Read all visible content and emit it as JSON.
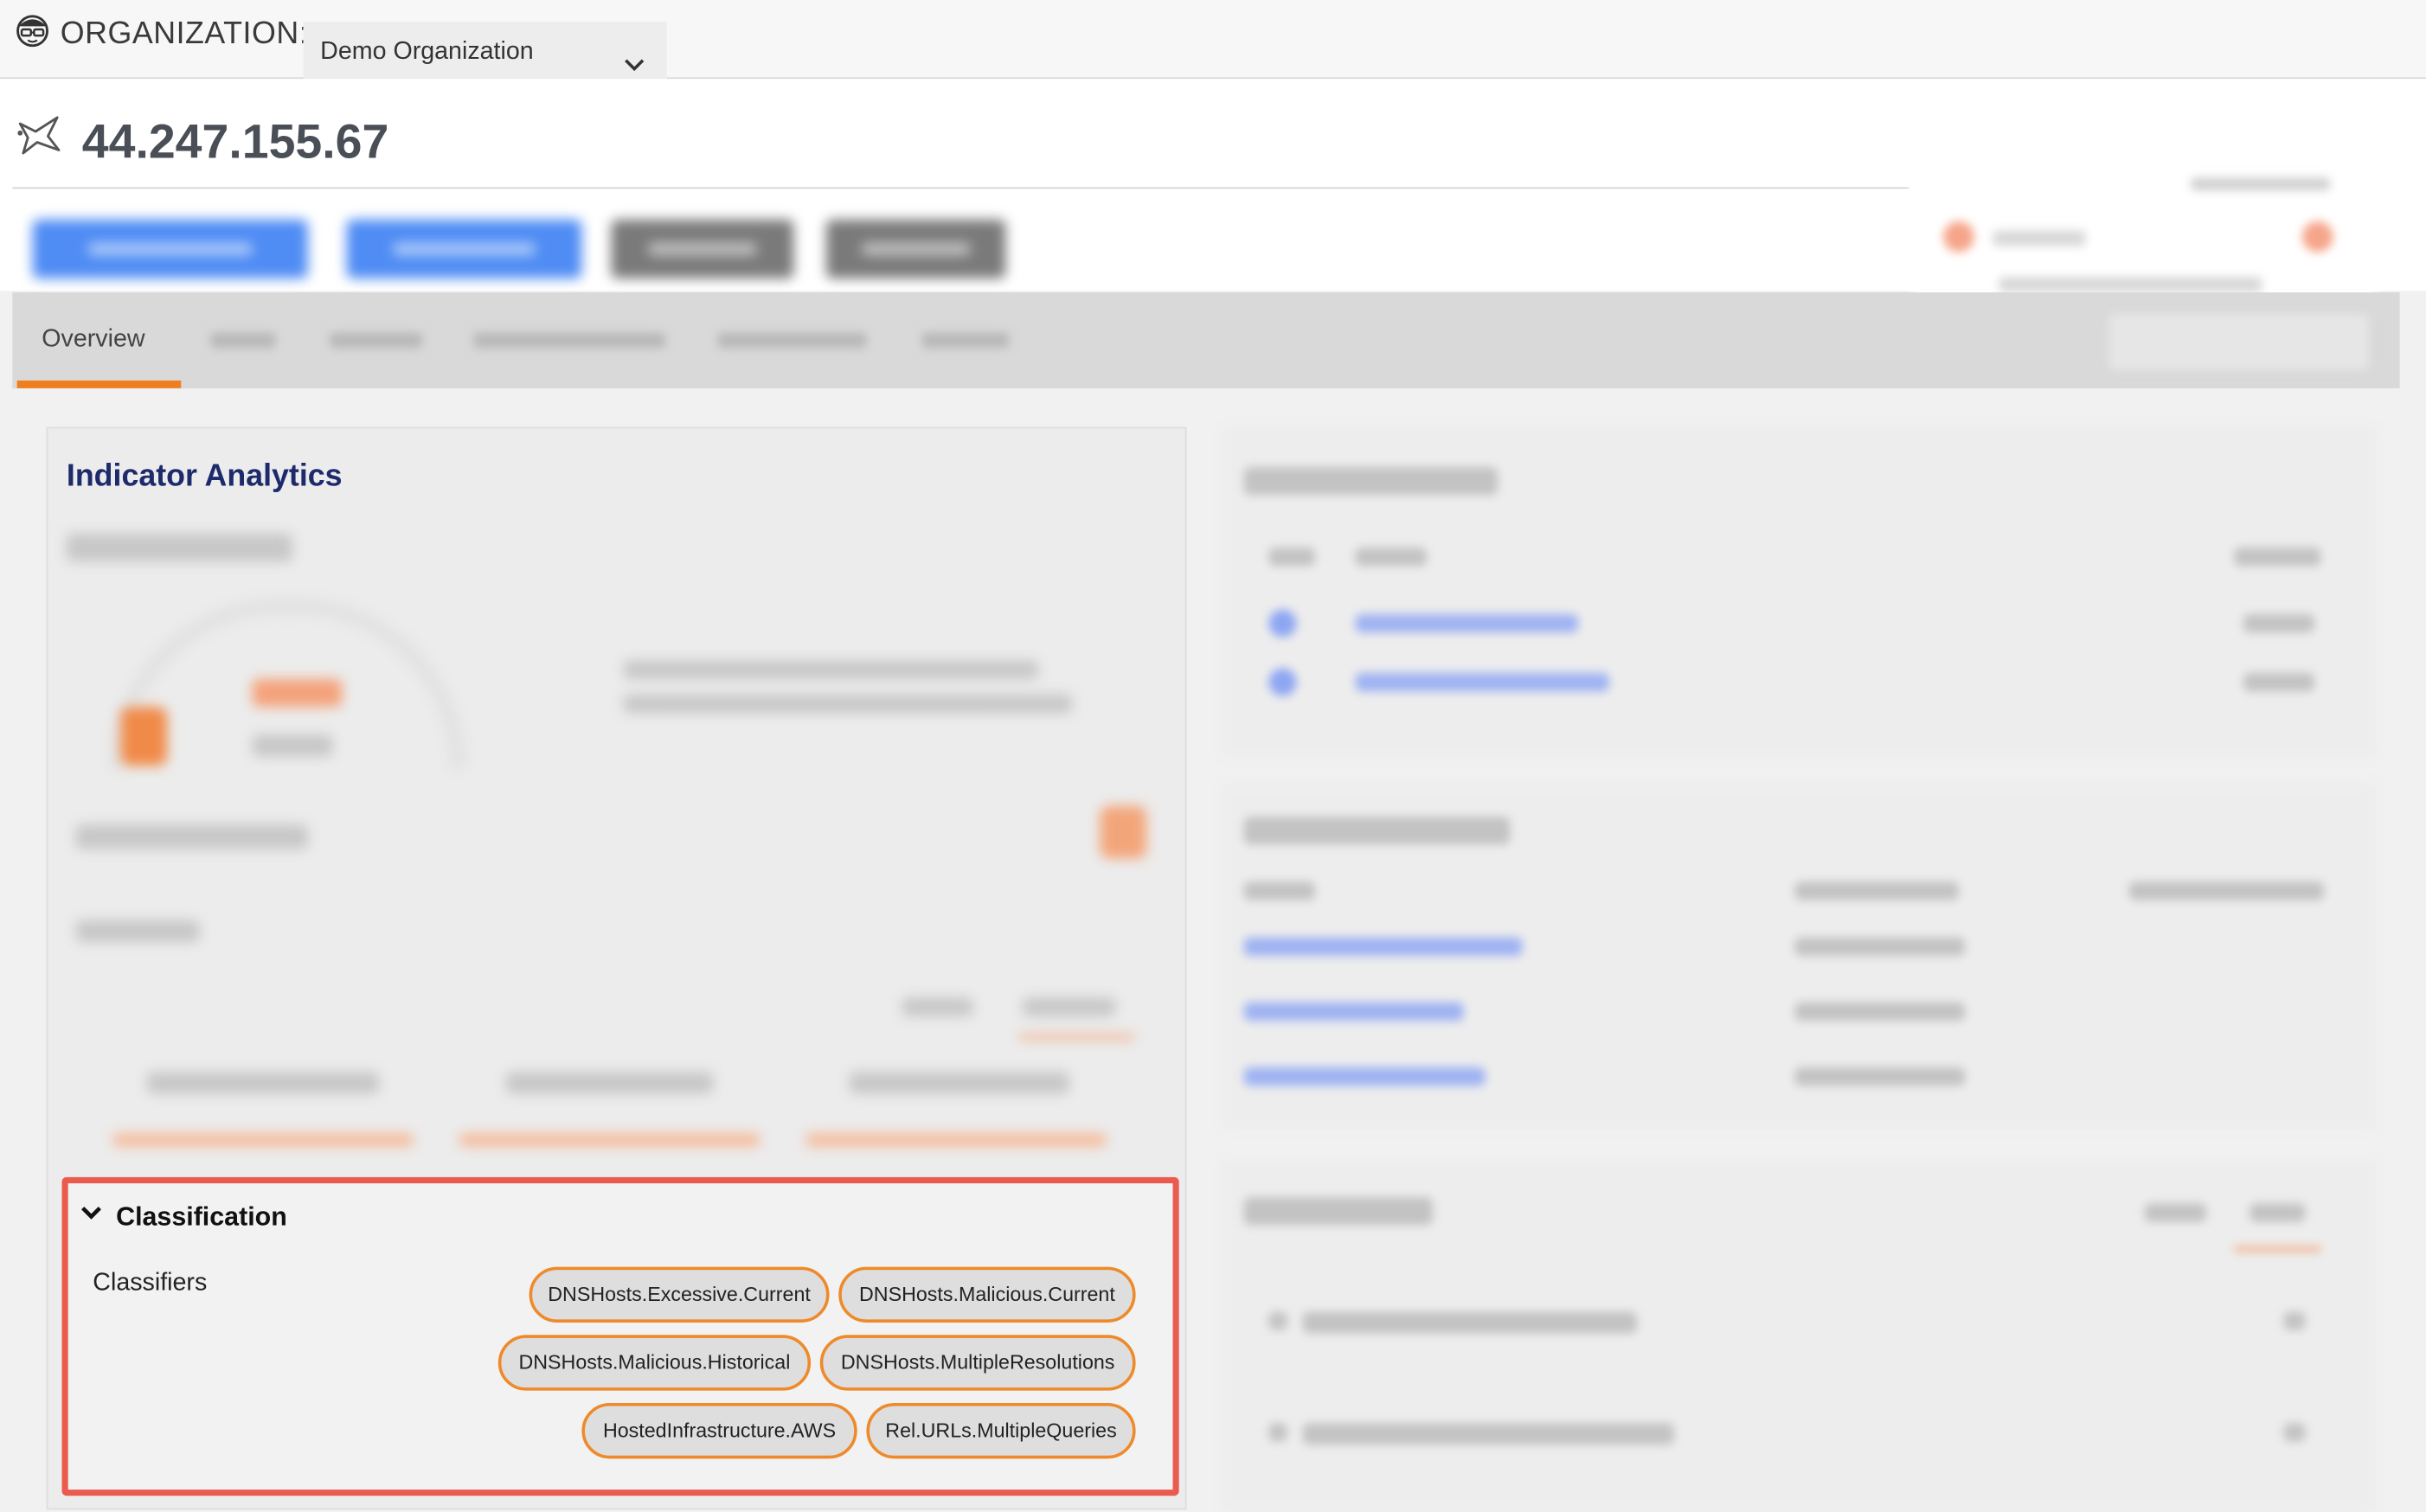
{
  "org_bar": {
    "label": "ORGANIZATION:",
    "selected_org": "Demo Organization",
    "icon": "user-glasses-icon",
    "select_icon": "chevron-down-icon"
  },
  "header": {
    "title": "44.247.155.67",
    "icon": "indicator-hand-icon"
  },
  "tabs": {
    "active_label": "Overview",
    "accent_color": "#f07e1e"
  },
  "left_card": {
    "title": "Indicator Analytics"
  },
  "classification": {
    "title": "Classification",
    "classifiers_label": "Classifiers",
    "chips": [
      "DNSHosts.Excessive.Current",
      "DNSHosts.Malicious.Current",
      "DNSHosts.Malicious.Historical",
      "DNSHosts.MultipleResolutions",
      "HostedInfrastructure.AWS",
      "Rel.URLs.MultipleQueries"
    ],
    "highlight_color": "#ea5a4e",
    "chip_border_color": "#ee8a2a"
  }
}
